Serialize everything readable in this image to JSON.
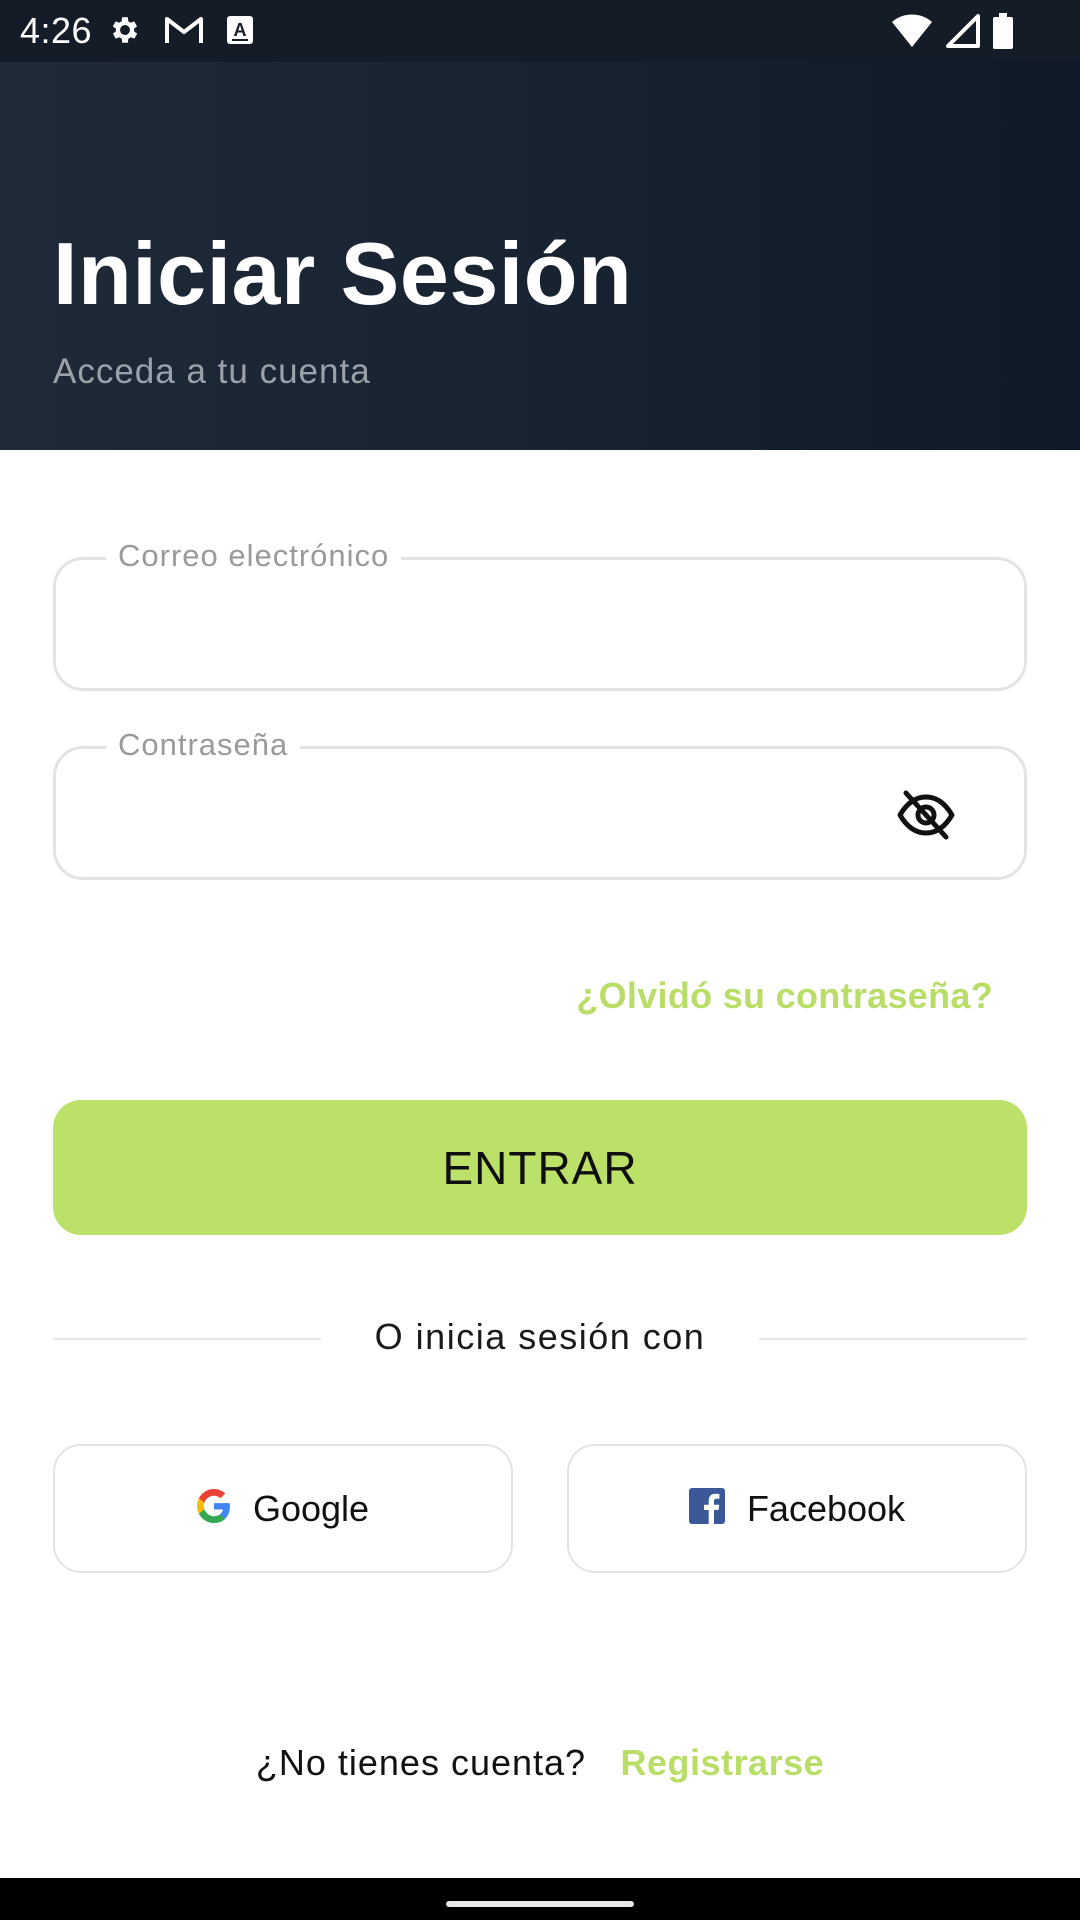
{
  "status_bar": {
    "time": "4:26",
    "left_icons": [
      "gear-icon",
      "gmail-icon",
      "a-icon"
    ],
    "right_icons": [
      "wifi-icon",
      "signal-icon",
      "battery-icon"
    ]
  },
  "header": {
    "title": "Iniciar Sesión",
    "subtitle": "Acceda a tu cuenta"
  },
  "form": {
    "email": {
      "label": "Correo electrónico",
      "value": ""
    },
    "password": {
      "label": "Contraseña",
      "value": "",
      "toggle_icon": "eye-off-icon"
    },
    "forgot_link": "¿Olvidó su contraseña?",
    "submit_label": "ENTRAR"
  },
  "social": {
    "divider_text": "O inicia sesión con",
    "google_label": "Google",
    "facebook_label": "Facebook"
  },
  "register": {
    "question": "¿No tienes cuenta?",
    "link": "Registrarse"
  },
  "colors": {
    "accent": "#bce169",
    "link": "#b9de67",
    "header_bg": "#182432",
    "facebook_blue": "#3b5998"
  }
}
